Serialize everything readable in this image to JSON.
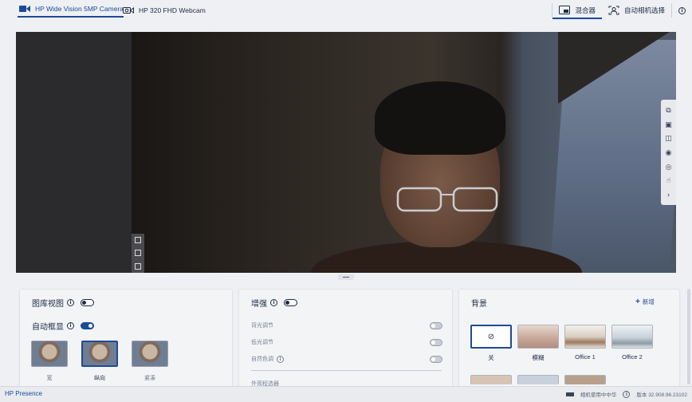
{
  "tabs": [
    {
      "label": "HP Wide Vision 5MP Camera",
      "active": true
    },
    {
      "label": "HP 320 FHD Webcam",
      "active": false
    }
  ],
  "toolbar": {
    "mixer_label": "混合器",
    "auto_select_label": "自动相机选择",
    "info_icon": "info-icon"
  },
  "gallery_panel": {
    "gallery_view_label": "图库视图",
    "gallery_view_on": false,
    "auto_framing_label": "自动框显",
    "auto_framing_on": true,
    "framing_options": [
      {
        "label": "宽",
        "selected": false
      },
      {
        "label": "纵向",
        "selected": true
      },
      {
        "label": "紧凑",
        "selected": false
      }
    ]
  },
  "enhance_panel": {
    "title": "增强",
    "enabled": false,
    "rows": [
      {
        "label": "背光调节",
        "has_info": false,
        "on": false
      },
      {
        "label": "低光调节",
        "has_info": false,
        "on": false
      },
      {
        "label": "自然色调",
        "has_info": true,
        "on": false
      }
    ],
    "next_section": "外观程选器"
  },
  "background_panel": {
    "title": "背景",
    "add_label": "新增",
    "items": [
      {
        "label": "关",
        "selected": true
      },
      {
        "label": "模糊",
        "selected": false
      },
      {
        "label": "Office 1",
        "selected": false
      },
      {
        "label": "Office 2",
        "selected": false
      }
    ]
  },
  "colors": {
    "accent": "#1d4a9a",
    "text": "#1f2a44",
    "panel_bg": "#f3f4f6"
  },
  "status": {
    "brand": "HP Presence",
    "status_text": "相机使用中中华",
    "version": "版本 32.908.96.23102"
  }
}
